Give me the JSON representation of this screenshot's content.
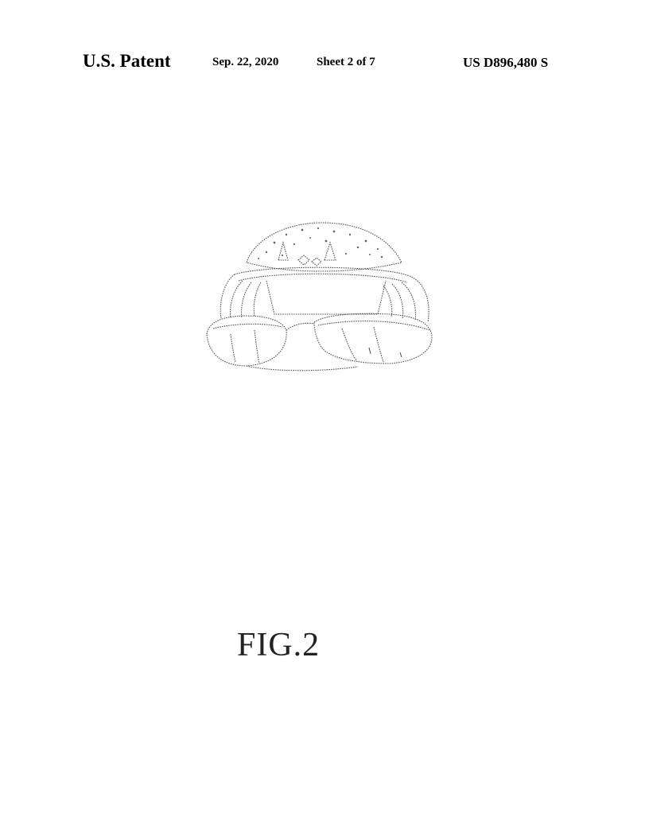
{
  "header": {
    "title": "U.S. Patent",
    "date": "Sep. 22, 2020",
    "sheet": "Sheet 2 of 7",
    "patent_number": "US D896,480 S"
  },
  "figure": {
    "label": "FIG.2",
    "icon": "hat-drawing-icon"
  }
}
